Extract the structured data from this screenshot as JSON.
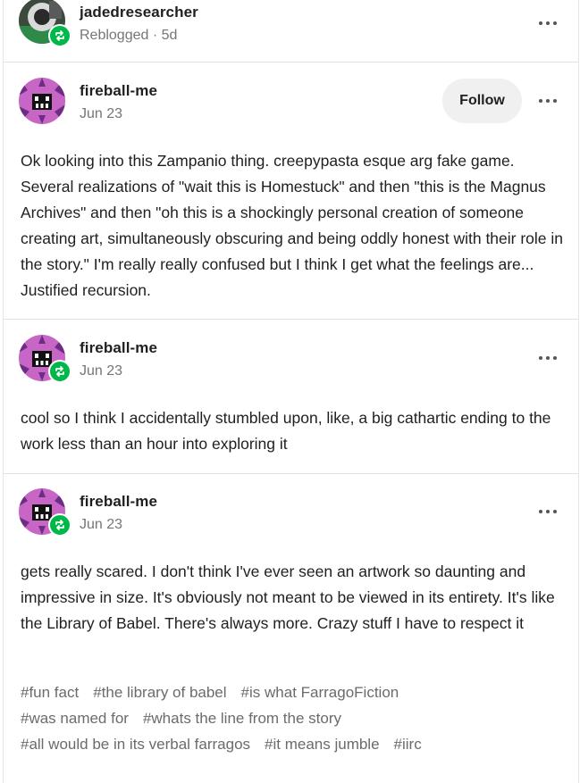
{
  "top_reblog": {
    "username": "jadedresearcher",
    "meta": "Reblogged · 5d"
  },
  "posts": [
    {
      "username": "fireball-me",
      "date": "Jun 23",
      "follow_label": "Follow",
      "body": "Ok looking into this Zampanio thing. creepypasta esque arg fake game. Several realizations of \"wait this is Homestuck\" and then \"this is the Magnus Archives\" and then \"oh this is a shockingly personal creation of someone creating art, simultaneously obscuring and being oddly honest with their role in the story.\" I'm really really confused but I think I get what the feelings are... Justified recursion."
    },
    {
      "username": "fireball-me",
      "date": "Jun 23",
      "body": "cool so I think I accidentally stumbled upon, like, a big cathartic ending to the work less than an hour into exploring it"
    },
    {
      "username": "fireball-me",
      "date": "Jun 23",
      "body": "gets really scared. I don't think I've ever seen an artwork so daunting and impressive in size. It's obviously not meant to be viewed in its entirety. It's like the Library of Babel. There's always more. Crazy stuff I have to respect it",
      "tags": [
        [
          "#fun fact",
          "#the library of babel",
          "#is what FarragoFiction"
        ],
        [
          "#was named for",
          "#whats the line from the story"
        ],
        [
          "#all would be in its verbal farragos",
          "#it means jumble",
          "#iirc"
        ]
      ]
    }
  ],
  "colors": {
    "reblog_badge": "#00b84a",
    "avatar_bg": "#c766c4",
    "tag_text": "#6b6b6b"
  },
  "icons": {
    "more": "more-options-icon",
    "reblog": "reblog-icon"
  }
}
